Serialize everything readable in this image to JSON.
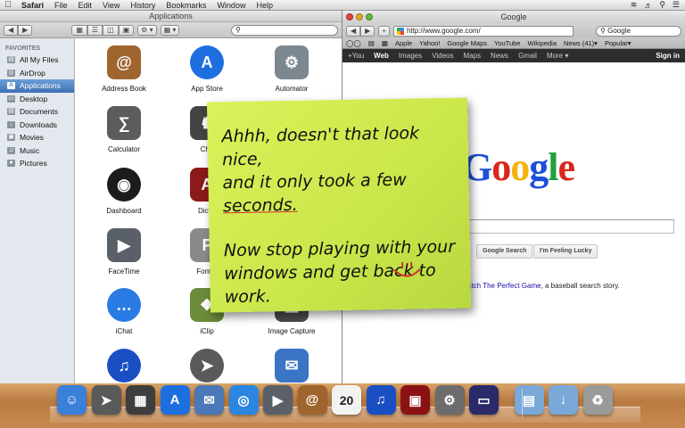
{
  "menubar": {
    "app": "Safari",
    "items": [
      "File",
      "Edit",
      "View",
      "History",
      "Bookmarks",
      "Window",
      "Help"
    ],
    "status_icons": [
      "wifi-icon",
      "volume-icon",
      "search-icon",
      "list-icon"
    ]
  },
  "finder": {
    "title": "Applications",
    "search_placeholder": "",
    "sidebar_heading": "FAVORITES",
    "sidebar_items": [
      {
        "label": "All My Files",
        "icon": "files-icon"
      },
      {
        "label": "AirDrop",
        "icon": "airdrop-icon"
      },
      {
        "label": "Applications",
        "icon": "applications-icon",
        "selected": true
      },
      {
        "label": "Desktop",
        "icon": "desktop-icon"
      },
      {
        "label": "Documents",
        "icon": "documents-icon"
      },
      {
        "label": "Downloads",
        "icon": "downloads-icon"
      },
      {
        "label": "Movies",
        "icon": "movies-icon"
      },
      {
        "label": "Music",
        "icon": "music-icon"
      },
      {
        "label": "Pictures",
        "icon": "pictures-icon"
      }
    ],
    "apps": [
      {
        "label": "Address Book",
        "icon": "address-book-icon",
        "color": "#a0652e"
      },
      {
        "label": "App Store",
        "icon": "app-store-icon",
        "color": "#1d6fe0"
      },
      {
        "label": "Automator",
        "icon": "automator-icon",
        "color": "#7d8790"
      },
      {
        "label": "Calculator",
        "icon": "calculator-icon",
        "color": "#5c5c5c"
      },
      {
        "label": "Che",
        "icon": "chess-icon",
        "color": "#444444"
      },
      {
        "label": "Dashboard",
        "icon": "dashboard-icon",
        "color": "#1c1c1c"
      },
      {
        "label": "Dictio",
        "icon": "dictionary-icon",
        "color": "#8b1a1a"
      },
      {
        "label": "FaceTime",
        "icon": "facetime-icon",
        "color": "#5a6068"
      },
      {
        "label": "Font B",
        "icon": "font-book-icon",
        "color": "#8a8a8a"
      },
      {
        "label": "iChat",
        "icon": "ichat-icon",
        "color": "#2a7be4"
      },
      {
        "label": "iClip",
        "icon": "iclip-icon",
        "color": "#6b8c3a"
      },
      {
        "label": "Image Capture",
        "icon": "image-capture-icon",
        "color": "#4a4a4a"
      },
      {
        "label": "",
        "icon": "itunes-icon",
        "color": "#1a4fc4"
      },
      {
        "label": "",
        "icon": "launchpad-icon",
        "color": "#5a5a5a"
      },
      {
        "label": "",
        "icon": "mail-icon",
        "color": "#3a74c4"
      }
    ]
  },
  "safari": {
    "title": "Google",
    "url": "http://www.google.com/",
    "search_placeholder": "Google",
    "bookmarks": [
      "Apple",
      "Yahoo!",
      "Google Maps",
      "YouTube",
      "Wikipedia",
      "News (41)▾",
      "Popular▾"
    ],
    "google_bar": [
      "+You",
      "Web",
      "Images",
      "Videos",
      "Maps",
      "News",
      "Gmail",
      "More ▾"
    ],
    "google_bar_active": "Web",
    "sign_in": "Sign in",
    "logo_letters": [
      "G",
      "o",
      "o",
      "g",
      "l",
      "e"
    ],
    "logo_colors": [
      "#1b4fd8",
      "#d8261c",
      "#f2b40c",
      "#1b4fd8",
      "#22a13e",
      "#d8261c"
    ],
    "search_button": "Google Search",
    "lucky_button": "I'm Feeling Lucky",
    "doodle_link": "atch The Perfect Game",
    "doodle_text": ", a baseball search story."
  },
  "note": {
    "line1": "Ahhh, doesn't that look nice,",
    "line2_pre": "and it only took a few ",
    "line2_em": "seconds.",
    "line3": "Now stop playing with your",
    "line4": "windows and get back to work."
  },
  "dock": {
    "items": [
      {
        "icon": "finder-icon",
        "color": "#3a7fd8"
      },
      {
        "icon": "launchpad-icon",
        "color": "#5a5a5a"
      },
      {
        "icon": "mission-control-icon",
        "color": "#3e3e3e"
      },
      {
        "icon": "app-store-icon",
        "color": "#1d6fe0"
      },
      {
        "icon": "mail-icon",
        "color": "#4b78b8"
      },
      {
        "icon": "safari-icon",
        "color": "#2a86e0"
      },
      {
        "icon": "facetime-icon",
        "color": "#5a6068"
      },
      {
        "icon": "address-book-icon",
        "color": "#a0652e"
      },
      {
        "icon": "ical-icon",
        "color": "#f2f2f2",
        "text": "20"
      },
      {
        "icon": "itunes-icon",
        "color": "#1a4fc4"
      },
      {
        "icon": "photo-booth-icon",
        "color": "#8b1212"
      },
      {
        "icon": "system-preferences-icon",
        "color": "#6c6c6c"
      },
      {
        "icon": "screen-sharing-icon",
        "color": "#2a2a6a"
      },
      {
        "icon": "applications-folder-icon",
        "color": "#7aa8d8"
      },
      {
        "icon": "downloads-folder-icon",
        "color": "#7aa8d8"
      },
      {
        "icon": "trash-icon",
        "color": "#9a9a9a"
      }
    ]
  }
}
